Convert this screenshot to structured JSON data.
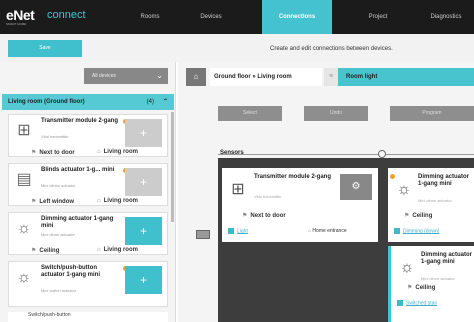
{
  "app": {
    "logo": "eNet",
    "logo_sub": "SMART HOME",
    "logo_connect": "connect"
  },
  "nav": {
    "tabs": [
      "Rooms",
      "Devices",
      "Connections",
      "Project",
      "Diagnostics"
    ],
    "active": "Connections"
  },
  "subbar": {
    "button_label": "Save",
    "description": "Create and edit connections between devices."
  },
  "left": {
    "filter": {
      "label": "All devices"
    },
    "group": {
      "title": "Living room (Ground floor)",
      "count": "(4)"
    },
    "cards": [
      {
        "title": "Transmitter module 2-gang",
        "subtitle": "Vital transmitter",
        "loc1": "Next to door",
        "loc2": "Living room",
        "add": "+"
      },
      {
        "title": "Blinds actuator 1-g... mini",
        "subtitle": "Mini blinds actuator",
        "loc1": "Left window",
        "loc2": "Living room",
        "add": "+"
      },
      {
        "title": "Dimming actuator 1-gang mini",
        "subtitle": "Mini dimm actuator",
        "loc1": "Ceiling",
        "loc2": "Living room",
        "add": "+"
      },
      {
        "title": "Switch/push-button actuator 1-gang mini",
        "subtitle": "Mini switch actuator",
        "add": "+"
      }
    ],
    "partial_next": "Switch/push-button"
  },
  "right": {
    "breadcrumb": "Ground floor » Living room",
    "breadcrumb_end": "Room light",
    "buttons": [
      "Select",
      "Undo",
      "Program"
    ],
    "sensors_label": "Sensors",
    "sensor_card": {
      "title": "Transmitter module 2-gang",
      "subtitle": "Vital transmitter",
      "loc": "Next to door",
      "foot_left": "Light",
      "foot_right": "Home entrance",
      "btn": "⚙"
    },
    "actuator_cards": [
      {
        "title": "Dimming actuator 1-gang mini",
        "subtitle": "Mini dimm actuator",
        "loc": "Ceiling",
        "foot": "Dimming (down)"
      },
      {
        "title": "Dimming actuator 1-gang mini",
        "subtitle": "Mini dimm actuator",
        "loc": "Ceiling",
        "foot": "Switched stair"
      }
    ]
  }
}
